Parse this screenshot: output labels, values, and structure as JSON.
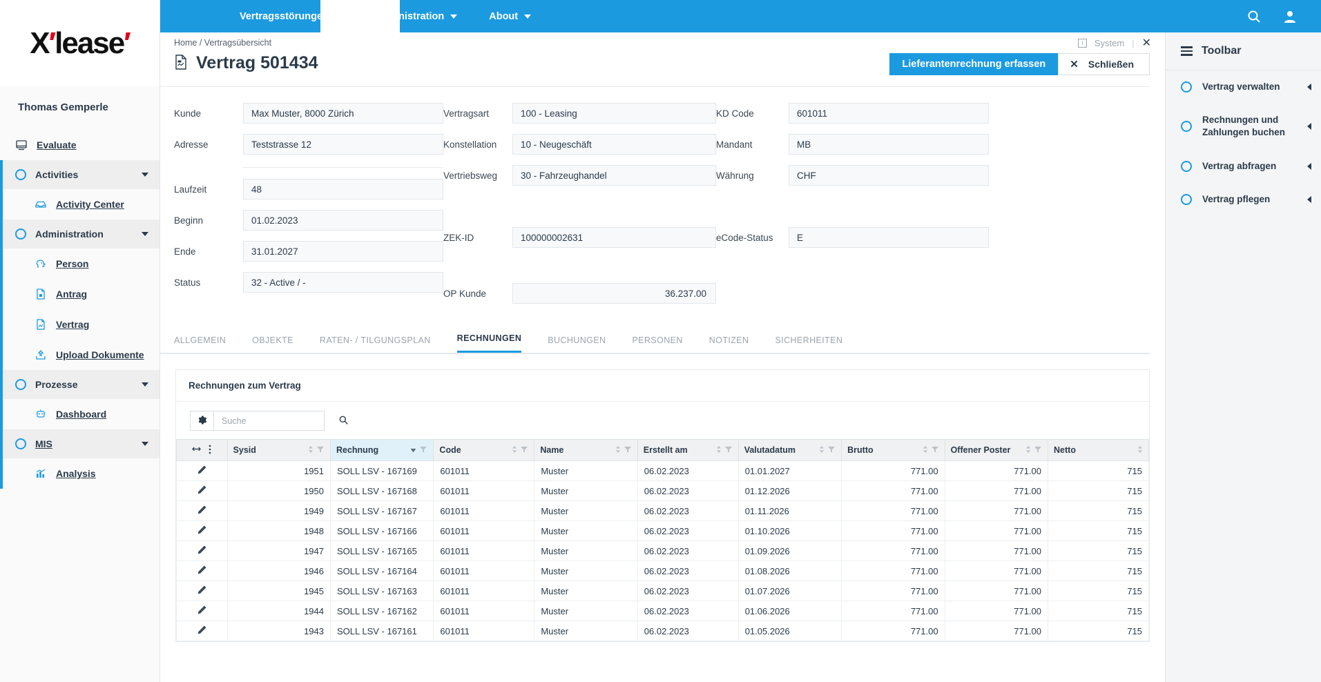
{
  "brand": {
    "logo_text": "X",
    "logo_rest": "lease",
    "accent": "#e2001a",
    "primary": "#1b9ae0"
  },
  "topbar": {
    "menus": [
      {
        "label": "Vertragsstörungen",
        "icon": "chevron-down-icon"
      },
      {
        "label": "Administration",
        "icon": "chevron-down-icon"
      },
      {
        "label": "About",
        "icon": "chevron-down-icon"
      }
    ],
    "search_icon": "search-icon",
    "user_icon": "user-icon"
  },
  "sidebar": {
    "user": "Thomas Gemperle",
    "evaluate": {
      "label": "Evaluate",
      "icon": "monitor-icon"
    },
    "groups": [
      {
        "label": "Activities",
        "icon": "circle-icon",
        "caret": "caret-down-icon",
        "children": [
          {
            "label": "Activity Center",
            "icon": "inbox-icon"
          }
        ]
      },
      {
        "label": "Administration",
        "icon": "circle-icon",
        "caret": "caret-down-icon",
        "children": [
          {
            "label": "Person",
            "icon": "person-icon"
          },
          {
            "label": "Antrag",
            "icon": "document-icon"
          },
          {
            "label": "Vertrag",
            "icon": "contract-icon"
          },
          {
            "label": "Upload Dokumente",
            "icon": "upload-icon"
          }
        ]
      },
      {
        "label": "Prozesse",
        "icon": "circle-icon",
        "caret": "caret-down-icon",
        "children": [
          {
            "label": "Dashboard",
            "icon": "robot-icon"
          }
        ]
      },
      {
        "label": "MIS",
        "icon": "circle-icon",
        "caret": "caret-down-icon",
        "underline": true,
        "children": [
          {
            "label": "Analysis",
            "icon": "chart-icon"
          }
        ]
      }
    ]
  },
  "breadcrumb": {
    "home": "Home",
    "sep": "/",
    "current": "Vertragsübersicht"
  },
  "window_chrome": {
    "system_label": "System",
    "system_icon": "info-icon",
    "divider": "|",
    "close_icon": "close-icon"
  },
  "page": {
    "title": "Vertrag 501434",
    "title_icon": "contract-document-icon",
    "primary_button": "Lieferantenrechnung erfassen",
    "close_button": "Schließen",
    "close_button_icon": "close-icon"
  },
  "form": {
    "col1": [
      {
        "label": "Kunde",
        "value": "Max Muster, 8000 Zürich"
      },
      {
        "label": "Adresse",
        "value": "Teststrasse 12"
      },
      {
        "label": "Laufzeit",
        "value": "48"
      },
      {
        "label": "Beginn",
        "value": "01.02.2023"
      },
      {
        "label": "Ende",
        "value": "31.01.2027"
      },
      {
        "label": "Status",
        "value": "32 - Active / -"
      }
    ],
    "col2": [
      {
        "label": "Vertragsart",
        "value": "100 - Leasing"
      },
      {
        "label": "Konstellation",
        "value": "10 - Neugeschäft"
      },
      {
        "label": "Vertriebsweg",
        "value": "30 - Fahrzeughandel"
      },
      {
        "label": "ZEK-ID",
        "value": "100000002631"
      },
      {
        "label": "OP Kunde",
        "value": "36.237.00"
      }
    ],
    "col3": [
      {
        "label": "KD Code",
        "value": "601011"
      },
      {
        "label": "Mandant",
        "value": "MB"
      },
      {
        "label": "Währung",
        "value": "CHF"
      },
      {
        "label": "eCode-Status",
        "value": "E"
      }
    ]
  },
  "tabs": [
    {
      "label": "ALLGEMEIN",
      "active": false
    },
    {
      "label": "OBJEKTE",
      "active": false
    },
    {
      "label": "RATEN- / TILGUNGSPLAN",
      "active": false
    },
    {
      "label": "RECHNUNGEN",
      "active": true
    },
    {
      "label": "BUCHUNGEN",
      "active": false
    },
    {
      "label": "PERSONEN",
      "active": false
    },
    {
      "label": "NOTIZEN",
      "active": false
    },
    {
      "label": "SICHERHEITEN",
      "active": false
    }
  ],
  "grid": {
    "title": "Rechnungen zum Vertrag",
    "settings_icon": "gear-icon",
    "search": {
      "placeholder": "Suche",
      "value": "",
      "icon": "search-icon"
    },
    "columns": [
      {
        "label": "",
        "key": "edit",
        "type": "icon",
        "sorted": false
      },
      {
        "label": "Sysid",
        "key": "sysid",
        "type": "num",
        "sorted": false
      },
      {
        "label": "Rechnung",
        "key": "rechnung",
        "type": "text",
        "sorted": true
      },
      {
        "label": "Code",
        "key": "code",
        "type": "text",
        "sorted": false
      },
      {
        "label": "Name",
        "key": "name",
        "type": "text",
        "sorted": false
      },
      {
        "label": "Erstellt am",
        "key": "erstellt",
        "type": "text",
        "sorted": false
      },
      {
        "label": "Valutadatum",
        "key": "valuta",
        "type": "text",
        "sorted": false
      },
      {
        "label": "Brutto",
        "key": "brutto",
        "type": "num",
        "sorted": false
      },
      {
        "label": "Offener Poster",
        "key": "offen",
        "type": "num",
        "sorted": false
      },
      {
        "label": "Netto",
        "key": "netto",
        "type": "num",
        "sorted": false
      }
    ],
    "rows": [
      {
        "edit": "pencil-icon",
        "sysid": "1951",
        "rechnung": "SOLL LSV - 167169",
        "code": "601011",
        "name": "Muster",
        "erstellt": "06.02.2023",
        "valuta": "01.01.2027",
        "brutto": "771.00",
        "offen": "771.00",
        "netto": "715"
      },
      {
        "edit": "pencil-icon",
        "sysid": "1950",
        "rechnung": "SOLL LSV - 167168",
        "code": "601011",
        "name": "Muster",
        "erstellt": "06.02.2023",
        "valuta": "01.12.2026",
        "brutto": "771.00",
        "offen": "771.00",
        "netto": "715"
      },
      {
        "edit": "pencil-icon",
        "sysid": "1949",
        "rechnung": "SOLL LSV - 167167",
        "code": "601011",
        "name": "Muster",
        "erstellt": "06.02.2023",
        "valuta": "01.11.2026",
        "brutto": "771.00",
        "offen": "771.00",
        "netto": "715"
      },
      {
        "edit": "pencil-icon",
        "sysid": "1948",
        "rechnung": "SOLL LSV - 167166",
        "code": "601011",
        "name": "Muster",
        "erstellt": "06.02.2023",
        "valuta": "01.10.2026",
        "brutto": "771.00",
        "offen": "771.00",
        "netto": "715"
      },
      {
        "edit": "pencil-icon",
        "sysid": "1947",
        "rechnung": "SOLL LSV - 167165",
        "code": "601011",
        "name": "Muster",
        "erstellt": "06.02.2023",
        "valuta": "01.09.2026",
        "brutto": "771.00",
        "offen": "771.00",
        "netto": "715"
      },
      {
        "edit": "pencil-icon",
        "sysid": "1946",
        "rechnung": "SOLL LSV - 167164",
        "code": "601011",
        "name": "Muster",
        "erstellt": "06.02.2023",
        "valuta": "01.08.2026",
        "brutto": "771.00",
        "offen": "771.00",
        "netto": "715"
      },
      {
        "edit": "pencil-icon",
        "sysid": "1945",
        "rechnung": "SOLL LSV - 167163",
        "code": "601011",
        "name": "Muster",
        "erstellt": "06.02.2023",
        "valuta": "01.07.2026",
        "brutto": "771.00",
        "offen": "771.00",
        "netto": "715"
      },
      {
        "edit": "pencil-icon",
        "sysid": "1944",
        "rechnung": "SOLL LSV - 167162",
        "code": "601011",
        "name": "Muster",
        "erstellt": "06.02.2023",
        "valuta": "01.06.2026",
        "brutto": "771.00",
        "offen": "771.00",
        "netto": "715"
      },
      {
        "edit": "pencil-icon",
        "sysid": "1943",
        "rechnung": "SOLL LSV - 167161",
        "code": "601011",
        "name": "Muster",
        "erstellt": "06.02.2023",
        "valuta": "01.05.2026",
        "brutto": "771.00",
        "offen": "771.00",
        "netto": "715"
      }
    ]
  },
  "toolbar": {
    "title": "Toolbar",
    "menu_icon": "hamburger-icon",
    "items": [
      {
        "label": "Vertrag verwalten",
        "icon": "circle-icon",
        "caret": "caret-left-icon"
      },
      {
        "label": "Rechnungen und Zahlungen buchen",
        "icon": "circle-icon",
        "caret": "caret-left-icon"
      },
      {
        "label": "Vertrag abfragen",
        "icon": "circle-icon",
        "caret": "caret-left-icon"
      },
      {
        "label": "Vertrag pflegen",
        "icon": "circle-icon",
        "caret": "caret-left-icon"
      }
    ]
  }
}
